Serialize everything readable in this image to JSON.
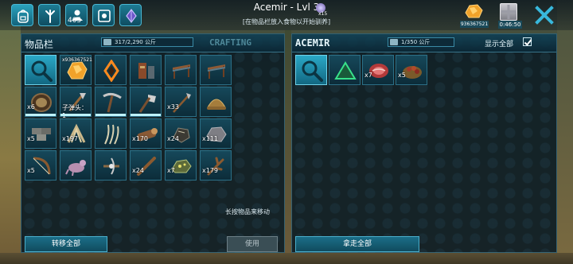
{
  "topbar": {
    "tabs": [
      {
        "icon": "backpack-icon"
      },
      {
        "icon": "footprint-icon"
      },
      {
        "icon": "tribe-icon",
        "count": "405"
      },
      {
        "icon": "settings-icon"
      },
      {
        "icon": "crystal-icon"
      }
    ],
    "title": "Acemir - Lvl 3",
    "title_badge_count": "x15",
    "subtitle": "[在物品栏放入食物以开始驯养]",
    "amber_count": "936367521",
    "gift_timer": "0:46:50"
  },
  "inventory": {
    "title": "物品栏",
    "weight": "317/2,290 公斤",
    "crafting_tab": "CRAFTING",
    "slots": [
      {
        "icon": "search-icon",
        "qty": "",
        "selected": true
      },
      {
        "icon": "amber-icon",
        "qty": "x936367521",
        "top": true
      },
      {
        "icon": "artifact-icon",
        "qty": ""
      },
      {
        "icon": "furniture-icon",
        "qty": ""
      },
      {
        "icon": "bench-icon",
        "qty": ""
      },
      {
        "icon": "bench-icon",
        "qty": ""
      },
      {
        "icon": "bowl-icon",
        "qty": "x6",
        "durability": true
      },
      {
        "icon": "torch-icon",
        "qty": "子弹头：1",
        "durability": true
      },
      {
        "icon": "pickaxe-icon",
        "qty": "",
        "durability": true
      },
      {
        "icon": "hatchet-icon",
        "qty": "",
        "durability": true
      },
      {
        "icon": "spear-icon",
        "qty": "x33"
      },
      {
        "icon": "pith-helmet-icon",
        "qty": ""
      },
      {
        "icon": "stone-icon",
        "qty": "x5"
      },
      {
        "icon": "thatch-icon",
        "qty": "x197"
      },
      {
        "icon": "fiber-icon",
        "qty": ""
      },
      {
        "icon": "wood-icon",
        "qty": "x170"
      },
      {
        "icon": "flint-icon",
        "qty": "x24"
      },
      {
        "icon": "rock-icon",
        "qty": "x111"
      },
      {
        "icon": "bow-icon",
        "qty": "x5"
      },
      {
        "icon": "creature-icon",
        "qty": ""
      },
      {
        "icon": "crossbow-icon",
        "qty": ""
      },
      {
        "icon": "stick-icon",
        "qty": "x24"
      },
      {
        "icon": "ore-icon",
        "qty": "x7"
      },
      {
        "icon": "branch-icon",
        "qty": "x179"
      }
    ],
    "hint": "长按物品来移动",
    "transfer_all": "转移全部",
    "use": "使用"
  },
  "creature": {
    "title": "ACEMIR",
    "weight": "1/350 公斤",
    "show_all": "显示全部",
    "slots": [
      {
        "icon": "search-icon",
        "qty": "",
        "selected": true
      },
      {
        "icon": "triangle-icon",
        "qty": ""
      },
      {
        "icon": "meat-icon",
        "qty": "x7"
      },
      {
        "icon": "berries-icon",
        "qty": "x5"
      }
    ],
    "take_all": "拿走全部"
  }
}
